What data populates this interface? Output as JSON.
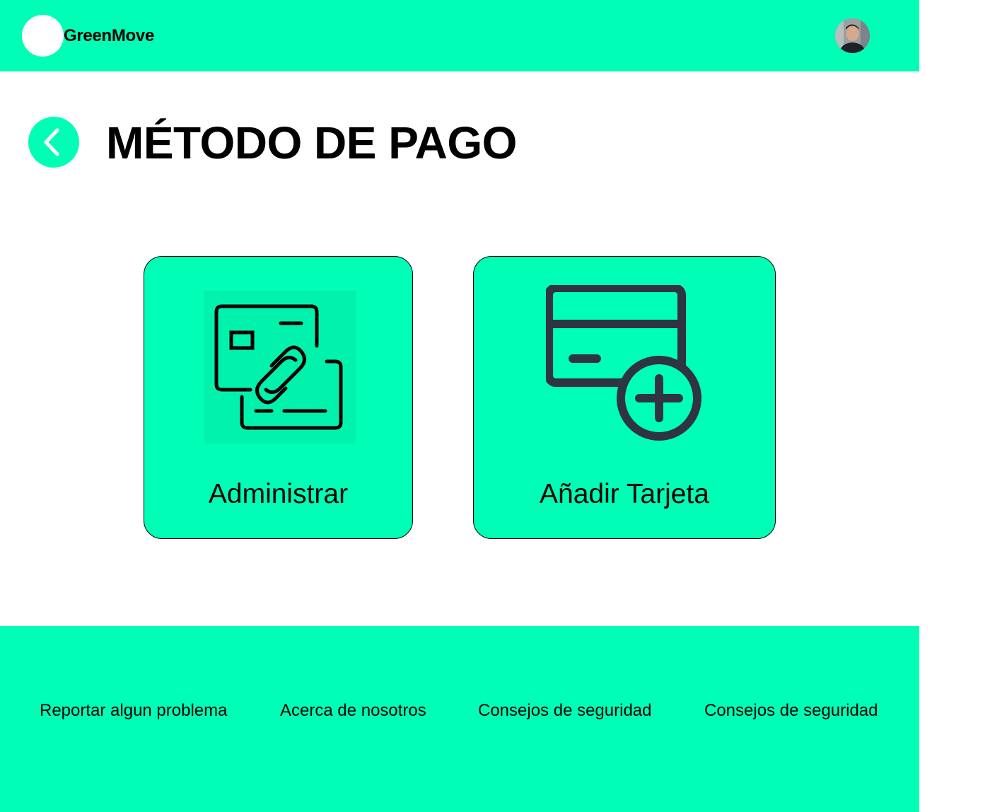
{
  "header": {
    "brand": "GreenMove",
    "avatar_icon": "user-avatar"
  },
  "page": {
    "title": "MÉTODO DE PAGO",
    "back_icon": "chevron-left-icon"
  },
  "cards": [
    {
      "label": "Administrar",
      "icon": "linked-cards-icon"
    },
    {
      "label": "Añadir Tarjeta",
      "icon": "add-card-icon"
    }
  ],
  "footer": {
    "links": [
      "Reportar algun problema",
      "Acerca de nosotros",
      "Consejos de seguridad",
      "Consejos de seguridad"
    ]
  },
  "colors": {
    "accent": "#00FFB6",
    "icon_dark": "#2E3440",
    "text": "#000000"
  }
}
